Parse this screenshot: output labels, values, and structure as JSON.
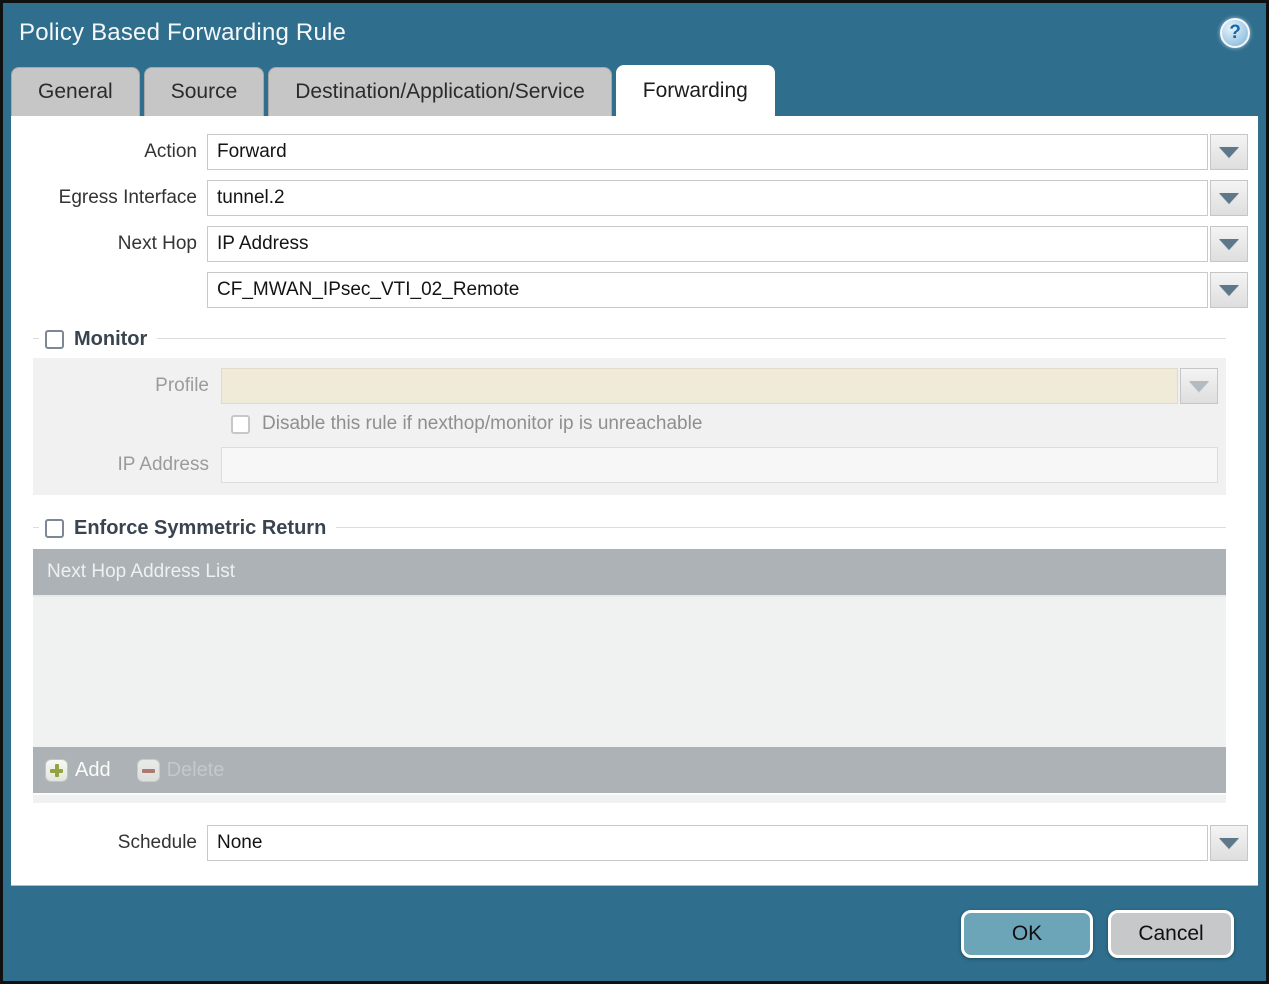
{
  "dialog": {
    "title": "Policy Based Forwarding Rule",
    "help_icon": "?"
  },
  "tabs": [
    {
      "label": "General",
      "active": false
    },
    {
      "label": "Source",
      "active": false
    },
    {
      "label": "Destination/Application/Service",
      "active": false
    },
    {
      "label": "Forwarding",
      "active": true
    }
  ],
  "form": {
    "action": {
      "label": "Action",
      "value": "Forward"
    },
    "egress_interface": {
      "label": "Egress Interface",
      "value": "tunnel.2"
    },
    "next_hop": {
      "label": "Next Hop",
      "value": "IP Address"
    },
    "next_hop_address": {
      "value": "CF_MWAN_IPsec_VTI_02_Remote"
    },
    "schedule": {
      "label": "Schedule",
      "value": "None"
    }
  },
  "monitor": {
    "title": "Monitor",
    "checked": false,
    "profile_label": "Profile",
    "profile_value": "",
    "disable_rule_label": "Disable this rule if nexthop/monitor ip is unreachable",
    "disable_rule_checked": false,
    "ip_address_label": "IP Address",
    "ip_address_value": ""
  },
  "symmetric_return": {
    "title": "Enforce Symmetric Return",
    "checked": false,
    "table_header": "Next Hop Address List",
    "rows": [],
    "add_label": "Add",
    "delete_label": "Delete"
  },
  "footer": {
    "ok_label": "OK",
    "cancel_label": "Cancel"
  },
  "colors": {
    "accent_teal": "#2f6e8d",
    "active_tab": "#ffffff",
    "inactive_tab": "#c6c6c6",
    "table_bar": "#adb2b6",
    "disabled_field_beige": "#f0ead8",
    "ok_button": "#6da5b8",
    "cancel_button": "#c7c8ca",
    "add_plus_green": "#93a33f",
    "delete_minus_red": "#ad7a72"
  }
}
